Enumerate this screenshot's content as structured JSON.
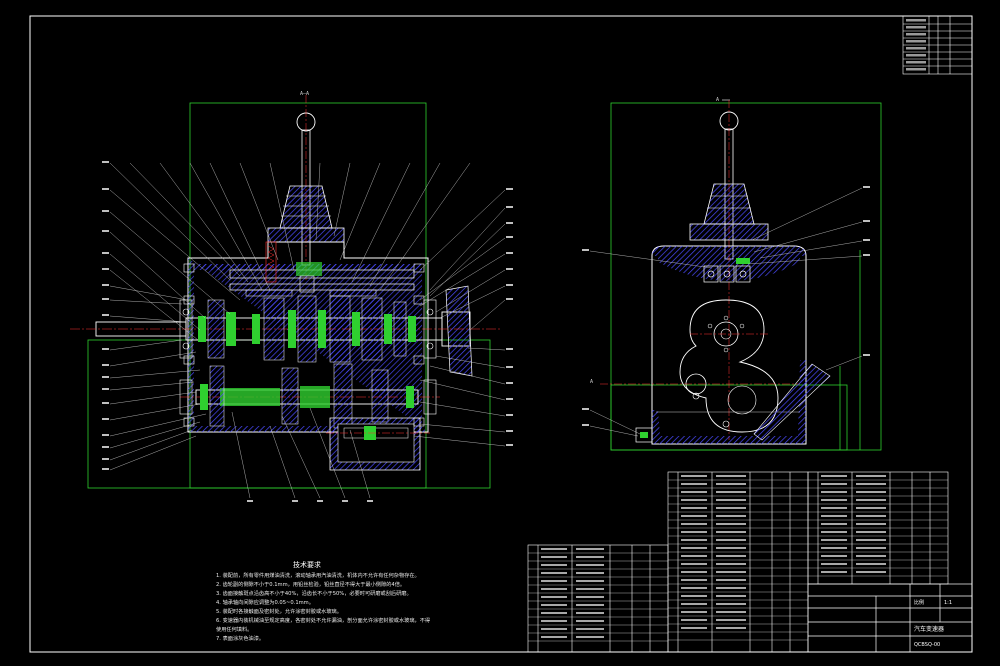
{
  "drawing": {
    "section_marker_front": "A—A",
    "section_marker_side": "A",
    "section_marker_side_low": "A"
  },
  "notes": {
    "title": "技术要求",
    "items": [
      "1. 装配前，所有零件用煤油清洗，滚动轴承用汽油清洗，机体内不允许有任何杂物存在。",
      "2. 齿轮副的侧隙不小于0.1mm，用铅丝检验，铅丝直径不得大于最小侧隙的4倍。",
      "3. 齿面接触斑点沿齿高不小于40%，沿齿长不小于50%，必要时可研磨或刮后研磨。",
      "4. 轴承轴向间隙应调整为0.05~0.1mm。",
      "5. 装配时各接触面及密封处，允许涂密封胶或水玻璃。",
      "6. 变速器内装机械油至规定高度，各密封处不允许漏油，剖分面允许涂密封胶或水玻璃，不得",
      "   使用任何填料。",
      "7. 表面涂灰色油漆。"
    ]
  },
  "title_block": {
    "name": "汽车变速器",
    "drawing_no": "QCBSQ-00",
    "scale_label": "比例",
    "scale_value": "1:1"
  },
  "colors": {
    "outline": "#ffffff",
    "envelope": "#2fd02f",
    "hatch": "#4a4aff",
    "centerline": "#ff3030",
    "leader": "#d8d8d8",
    "gear": "#2fd02f"
  }
}
